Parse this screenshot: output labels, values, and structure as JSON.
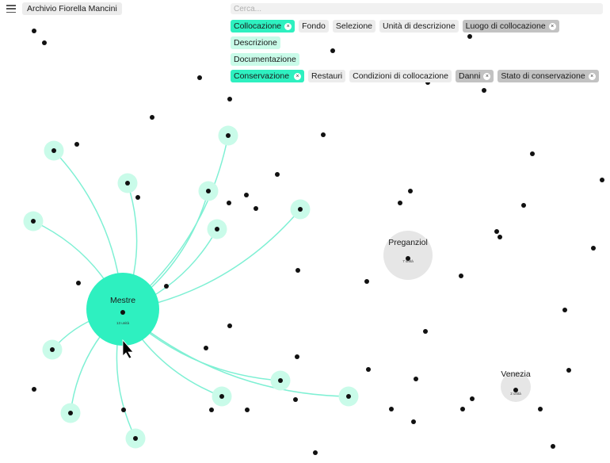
{
  "app": {
    "title": "Archivio Fiorella Mancini"
  },
  "search": {
    "placeholder": "Cerca..."
  },
  "filters": {
    "row1": [
      {
        "label": "Collocazione",
        "state": "active",
        "closable": true
      },
      {
        "label": "Fondo",
        "state": "default",
        "closable": false
      },
      {
        "label": "Selezione",
        "state": "default",
        "closable": false
      },
      {
        "label": "Unità di descrizione",
        "state": "default",
        "closable": false
      },
      {
        "label": "Luogo di collocazione",
        "state": "grey",
        "closable": true
      }
    ],
    "row2": [
      {
        "label": "Descrizione",
        "state": "soft",
        "closable": false
      }
    ],
    "row3": [
      {
        "label": "Documentazione",
        "state": "soft",
        "closable": false
      }
    ],
    "row4": [
      {
        "label": "Conservazione",
        "state": "active",
        "closable": true
      },
      {
        "label": "Restauri",
        "state": "default",
        "closable": false
      },
      {
        "label": "Condizioni di collocazione",
        "state": "default",
        "closable": false
      },
      {
        "label": "Danni",
        "state": "grey",
        "closable": true
      },
      {
        "label": "Stato di conservazione",
        "state": "grey",
        "closable": true
      }
    ]
  },
  "colors": {
    "accent": "#2ef0c0",
    "accent_soft": "#c9fbe9",
    "grey_node": "#e6e6e6",
    "dot": "#111111",
    "link": "#7ff0d4"
  },
  "places": [
    {
      "name": "Mestre",
      "units": "13 unità",
      "style": "accent"
    },
    {
      "name": "Preganziol",
      "units": "7 unità",
      "style": "grey"
    },
    {
      "name": "Venezia",
      "units": "2 unità",
      "style": "grey"
    }
  ],
  "icons": {
    "menu": "menu-icon",
    "close": "close-icon",
    "cursor": "cursor-arrow-icon"
  }
}
